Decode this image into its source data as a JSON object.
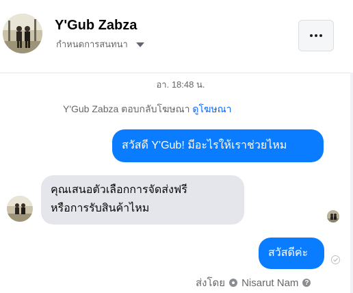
{
  "header": {
    "name": "Y'Gub Zabza",
    "subtitle": "กำหนดการสนทนา",
    "more_label": "more"
  },
  "chat": {
    "timestamp": "อา. 18:48 น.",
    "system_text": "Y'Gub Zabza ตอบกลับโฆษณา",
    "system_link": "ดูโฆษณา",
    "messages": [
      {
        "direction": "out",
        "text": "สวัสดี Y'Gub! มีอะไรให้เราช่วยไหม"
      },
      {
        "direction": "in",
        "lines": [
          "คุณเสนอตัวเลือกการจัดส่งฟรี",
          "หรือการรับสินค้าไหม"
        ]
      },
      {
        "direction": "out",
        "text": "สวัสดีค่ะ"
      }
    ],
    "sent_by_label": "ส่งโดย",
    "sent_by_name": "Nisarut Nam"
  },
  "icons": {
    "caret": "chevron-down-icon",
    "more": "more-dots-icon",
    "check": "seen-check-icon",
    "help": "help-icon",
    "sender_badge": "sender-icon"
  },
  "colors": {
    "outgoing_bubble": "#0a7cff",
    "incoming_bubble": "#e4e6eb",
    "link": "#0866ff",
    "muted_text": "#65676b"
  }
}
